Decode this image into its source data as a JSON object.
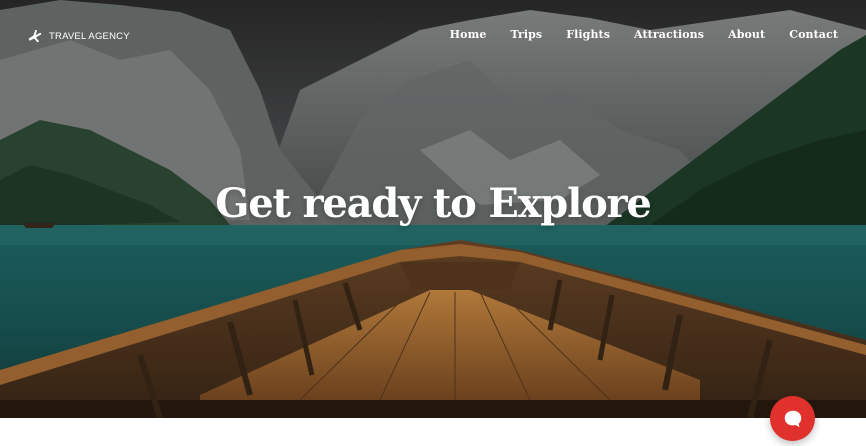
{
  "brand": {
    "name": "TRAVEL AGENCY",
    "icon": "airplane-icon"
  },
  "nav": {
    "items": [
      "Home",
      "Trips",
      "Flights",
      "Attractions",
      "About",
      "Contact"
    ]
  },
  "hero": {
    "headline": "Get ready to Explore",
    "background": "lake-mountains-rowboat-photo"
  },
  "chat": {
    "icon": "chat-bubble-icon",
    "color": "#e0312d"
  },
  "colors": {
    "nav_text": "#ffffff",
    "page_background": "#ffffff"
  }
}
